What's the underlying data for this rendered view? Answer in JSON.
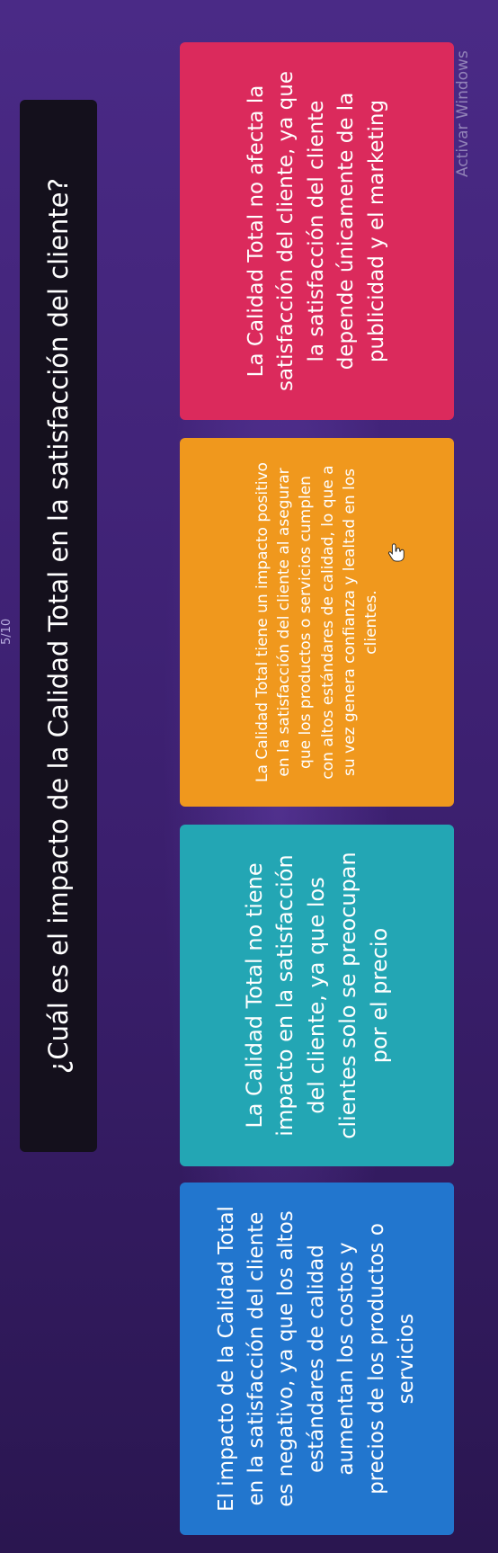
{
  "quiz": {
    "counter": "5/10",
    "question": "¿Cuál es el impacto de la Calidad Total en la satisfacción del cliente?",
    "answers": [
      {
        "text": "El impacto de la Calidad Total en la satisfacción del cliente es negativo, ya que los altos estándares de calidad aumentan los costos y precios de los productos o servicios",
        "color": "#2276ce"
      },
      {
        "text": "La Calidad Total no tiene impacto en la satisfacción del cliente, ya que los clientes solo se preocupan por el precio",
        "color": "#23a6b4"
      },
      {
        "text": "La Calidad Total tiene un impacto positivo en la satisfacción del cliente al asegurar que los productos o servicios cumplen con altos estándares de calidad, lo que a su vez genera confianza y lealtad en los clientes.",
        "color": "#f0981d"
      },
      {
        "text": "La Calidad Total no afecta la satisfacción del cliente, ya que la satisfacción del cliente depende únicamente de la publicidad y el marketing",
        "color": "#db2a5c"
      }
    ]
  },
  "os": {
    "watermark": "Activar Windows"
  },
  "icons": {
    "cursor": "hand-pointer-icon"
  }
}
